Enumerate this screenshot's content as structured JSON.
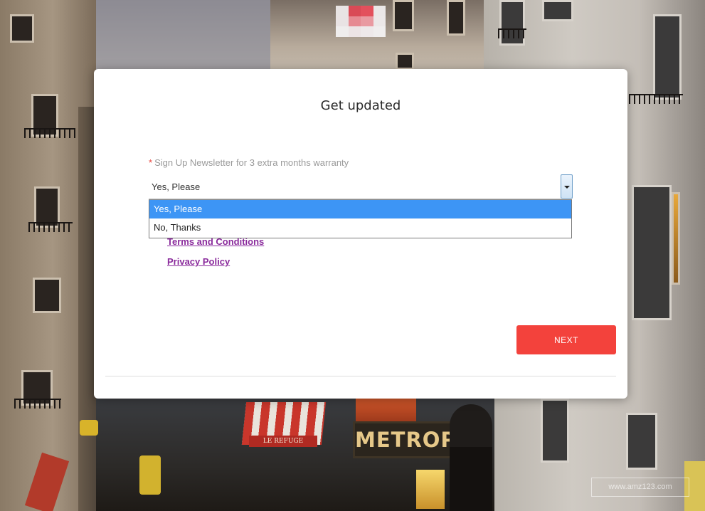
{
  "modal": {
    "title": "Get updated",
    "newsletter_field": {
      "required_marker": "*",
      "label": "Sign Up Newsletter for 3 extra months warranty",
      "selected_value": "Yes, Please",
      "options": [
        {
          "label": "Yes, Please",
          "highlighted": true
        },
        {
          "label": "No, Thanks",
          "highlighted": false
        }
      ]
    },
    "links": {
      "terms": "Terms and Conditions",
      "privacy": "Privacy Policy"
    },
    "next_label": "NEXT"
  },
  "background": {
    "awning_text": "LE REFUGE",
    "metro_sign": "METROPOL"
  },
  "watermark": "www.amz123.com",
  "colors": {
    "accent_button": "#f3423c",
    "option_highlight": "#3d95f5",
    "link": "#8a2a9c",
    "required": "#e8423a"
  }
}
